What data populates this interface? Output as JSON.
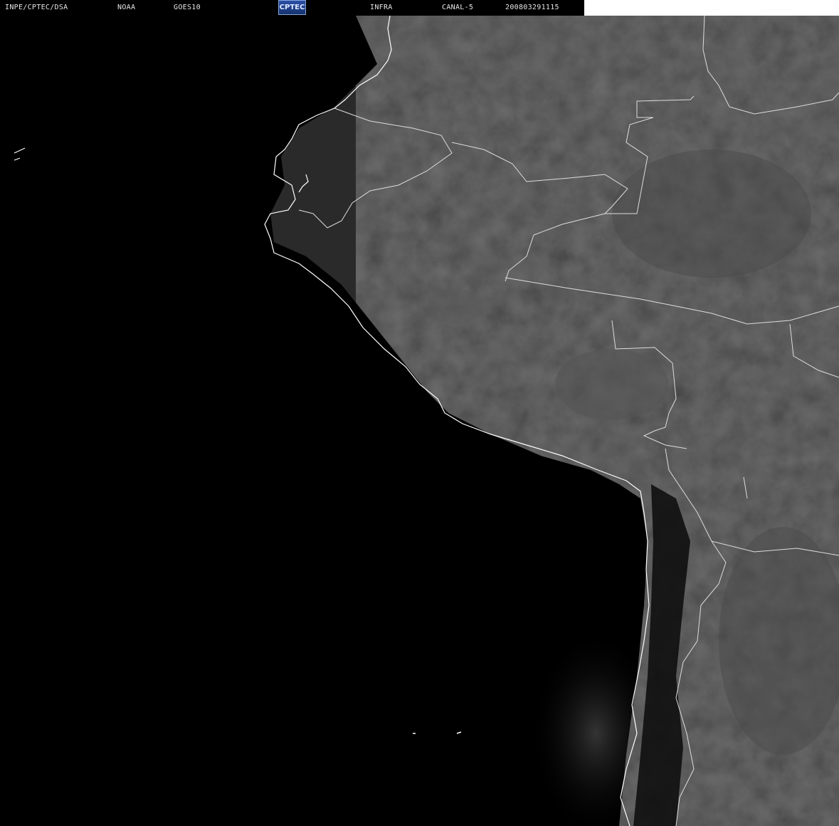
{
  "header": {
    "agency": "INPE/CPTEC/DSA",
    "satellite_operator": "NOAA",
    "satellite": "GOES10",
    "logo_text": "CPTEC",
    "product": "INFRA",
    "channel": "CANAL-5",
    "timestamp": "200803291115"
  },
  "colors": {
    "background": "#000000",
    "coastline": "#ffffff",
    "cloud_land": "#3a3a3a",
    "header_blank": "#ffffff"
  },
  "icons": {
    "logo": "cptec-logo"
  }
}
